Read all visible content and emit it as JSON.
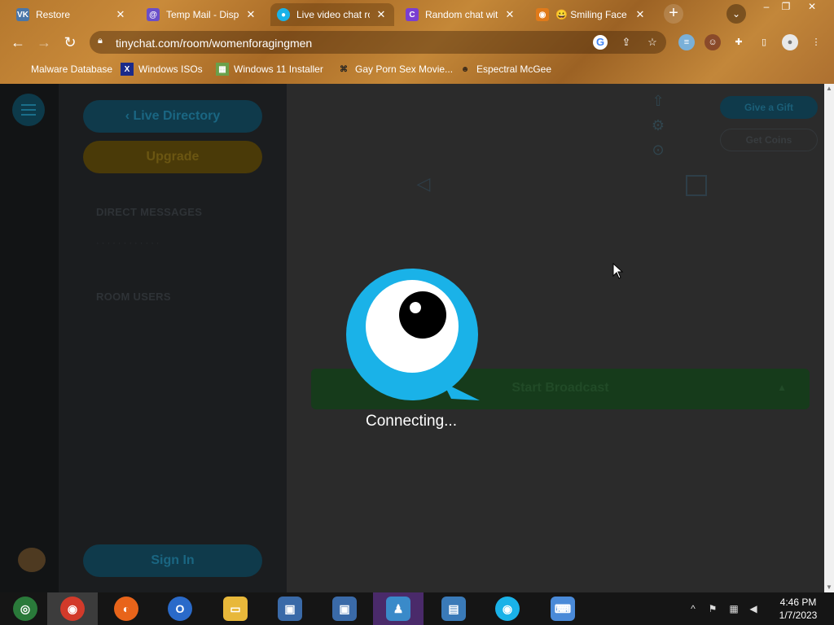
{
  "browser": {
    "tabs": [
      {
        "title": "Restore",
        "favicon": "vk-icon",
        "color": "#4a76a8",
        "glyph": "VK"
      },
      {
        "title": "Temp Mail - Dispo",
        "favicon": "at-icon",
        "color": "#6a4fc9",
        "glyph": "@"
      },
      {
        "title": "Live video chat ro",
        "favicon": "tinychat-icon",
        "color": "#1ab2e8",
        "glyph": "●"
      },
      {
        "title": "Random chat with",
        "favicon": "c-icon",
        "color": "#7a3fd1",
        "glyph": "C"
      },
      {
        "title": "😀 Smiling Face wi",
        "favicon": "emoji-site-icon",
        "color": "#e07a1a",
        "glyph": "◉"
      }
    ],
    "active_tab_index": 2,
    "url": "tinychat.com/room/womenforagingmen",
    "bookmarks": [
      {
        "label": "Malware Database",
        "icon": "bug-icon",
        "color": "#c08a2a",
        "glyph": ""
      },
      {
        "label": "Windows ISOs",
        "icon": "x-icon",
        "color": "#1a2a8a",
        "glyph": "X"
      },
      {
        "label": "Windows 11 Installer",
        "icon": "image-icon",
        "color": "#6aa04a",
        "glyph": "▦"
      },
      {
        "label": "Gay Porn Sex Movie...",
        "icon": "globe-icon",
        "color": "#444",
        "glyph": "⌘"
      },
      {
        "label": "Espectral McGee",
        "icon": "avatar-icon",
        "color": "#5a3a1a",
        "glyph": "☻"
      }
    ]
  },
  "sidebar": {
    "live_directory": "Live Directory",
    "upgrade": "Upgrade",
    "direct_messages": "DIRECT MESSAGES",
    "dm_note": "· · · · · · · · · · · ·",
    "room_users": "ROOM USERS",
    "sign_in": "Sign In"
  },
  "main": {
    "give_gift": "Give a Gift",
    "get_coins": "Get Coins",
    "start_broadcast": "Start Broadcast",
    "connecting": "Connecting..."
  },
  "taskbar": {
    "apps": [
      {
        "name": "chrome-canary-icon",
        "color": "#2a7a3a",
        "glyph": "◎"
      },
      {
        "name": "chrome-icon",
        "color": "#d23a2a",
        "glyph": "◉"
      },
      {
        "name": "firefox-icon",
        "color": "#e8641a",
        "glyph": "◐"
      },
      {
        "name": "opera-icon",
        "color": "#2a6ac9",
        "glyph": "O"
      },
      {
        "name": "file-explorer-icon",
        "color": "#e8b83a",
        "glyph": "▭"
      },
      {
        "name": "setup-icon-1",
        "color": "#3a6aa8",
        "glyph": "▣"
      },
      {
        "name": "setup-icon-2",
        "color": "#3a6aa8",
        "glyph": "▣"
      },
      {
        "name": "messenger-icon",
        "color": "#3a8ac9",
        "glyph": "♟"
      },
      {
        "name": "photo-viewer-icon",
        "color": "#3a7ab8",
        "glyph": "▤"
      },
      {
        "name": "camera-app-icon",
        "color": "#1ab2e8",
        "glyph": "◉"
      },
      {
        "name": "keyboard-icon",
        "color": "#4a8ad8",
        "glyph": "⌨"
      }
    ],
    "time": "4:46 PM",
    "date": "1/7/2023"
  }
}
